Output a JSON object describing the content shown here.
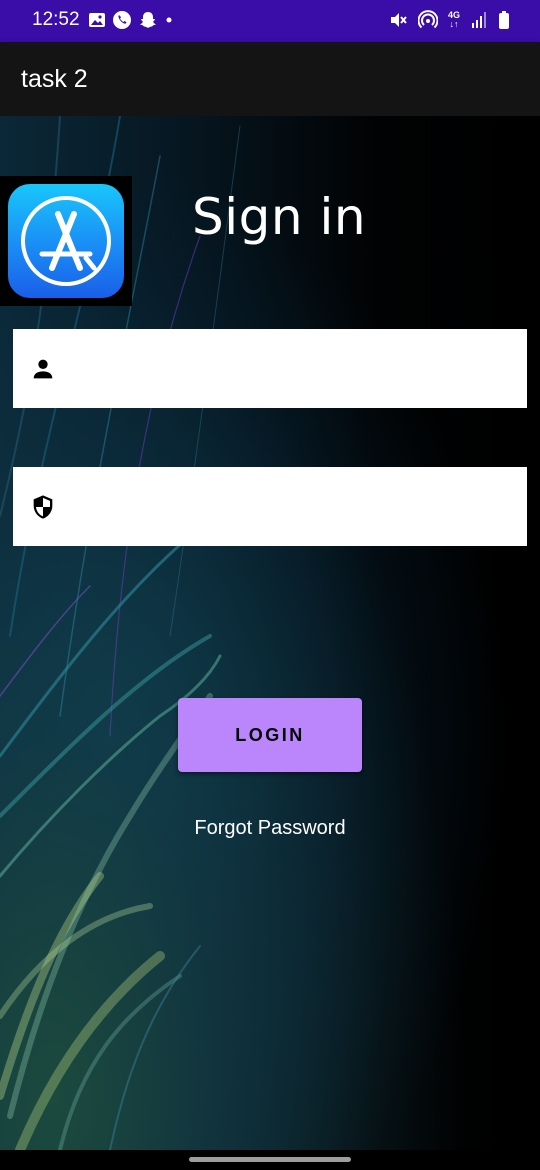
{
  "status_bar": {
    "time": "12:52",
    "left_icons": [
      "gallery-icon",
      "phone-icon",
      "snapchat-icon",
      "dot-icon"
    ],
    "right_icons": [
      "mute-icon",
      "hotspot-icon",
      "network-4g-icon",
      "signal-icon",
      "battery-icon"
    ],
    "network_label": "4G",
    "background_color": "#3a0ca8"
  },
  "app_bar": {
    "title": "task 2",
    "background_color": "#141414"
  },
  "login": {
    "heading": "Sign in",
    "logo_icon": "app-store-icon",
    "username_field": {
      "icon": "person-icon",
      "value": "",
      "placeholder": ""
    },
    "password_field": {
      "icon": "shield-icon",
      "value": "",
      "placeholder": ""
    },
    "login_button_label": "LOGIN",
    "login_button_color": "#bb86fc",
    "forgot_password_label": "Forgot Password"
  }
}
